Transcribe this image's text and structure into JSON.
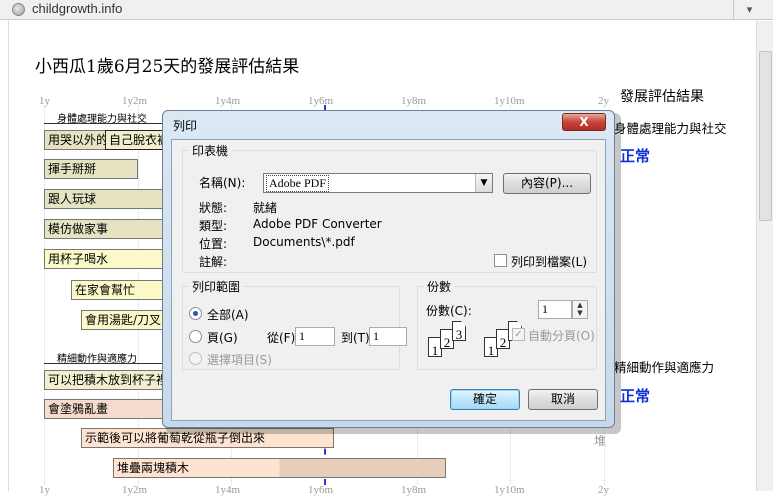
{
  "browser": {
    "url": "childgrowth.info"
  },
  "page": {
    "title": "小西瓜1歲6月25天的發展評估結果",
    "axis_ticks": [
      "1y",
      "1y2m",
      "1y4m",
      "1y6m",
      "1y8m",
      "1y10m",
      "2y"
    ],
    "sections": [
      {
        "label": "身體處理能力與社交",
        "bars": [
          "用哭以外的",
          "自己脫衣褲",
          "揮手掰掰",
          "跟人玩球",
          "模仿做家事",
          "用杯子喝水",
          "在家會幫忙",
          "會用湯匙/刀叉"
        ]
      },
      {
        "label": "精細動作與適應力",
        "bars": [
          "可以把積木放到杯子裡",
          "會塗鴉亂畫",
          "示範後可以將葡萄乾從瓶子倒出來",
          "堆疊兩塊積木"
        ],
        "partial_right_label": "堆"
      }
    ],
    "results": {
      "header": "發展評估結果",
      "categories": [
        {
          "name": "身體處理能力與社交",
          "status": "正常"
        },
        {
          "name": "精細動作與適應力",
          "status": "正常"
        }
      ]
    }
  },
  "dialog": {
    "title": "列印",
    "close_label": "X",
    "printer_group": "印表機",
    "name_label": "名稱(N):",
    "printer_name": "Adobe PDF",
    "properties_button": "內容(P)...",
    "status_label": "狀態:",
    "status_value": "就緒",
    "type_label": "類型:",
    "type_value": "Adobe PDF Converter",
    "location_label": "位置:",
    "location_value": "Documents\\*.pdf",
    "comment_label": "註解:",
    "print_to_file_label": "列印到檔案(L)",
    "range_group": "列印範圍",
    "range_all": "全部(A)",
    "range_pages": "頁(G)",
    "from_label": "從(F):",
    "from_value": "1",
    "to_label": "到(T):",
    "to_value": "1",
    "range_selection": "選擇項目(S)",
    "copies_group": "份數",
    "copies_label": "份數(C):",
    "copies_value": "1",
    "collate_label": "自動分頁(O)",
    "ok_button": "確定",
    "cancel_button": "取消"
  },
  "colors": {
    "status_blue": "#1030e0",
    "dialog_frame": "#c6d9ec",
    "close_red": "#c8443b"
  }
}
